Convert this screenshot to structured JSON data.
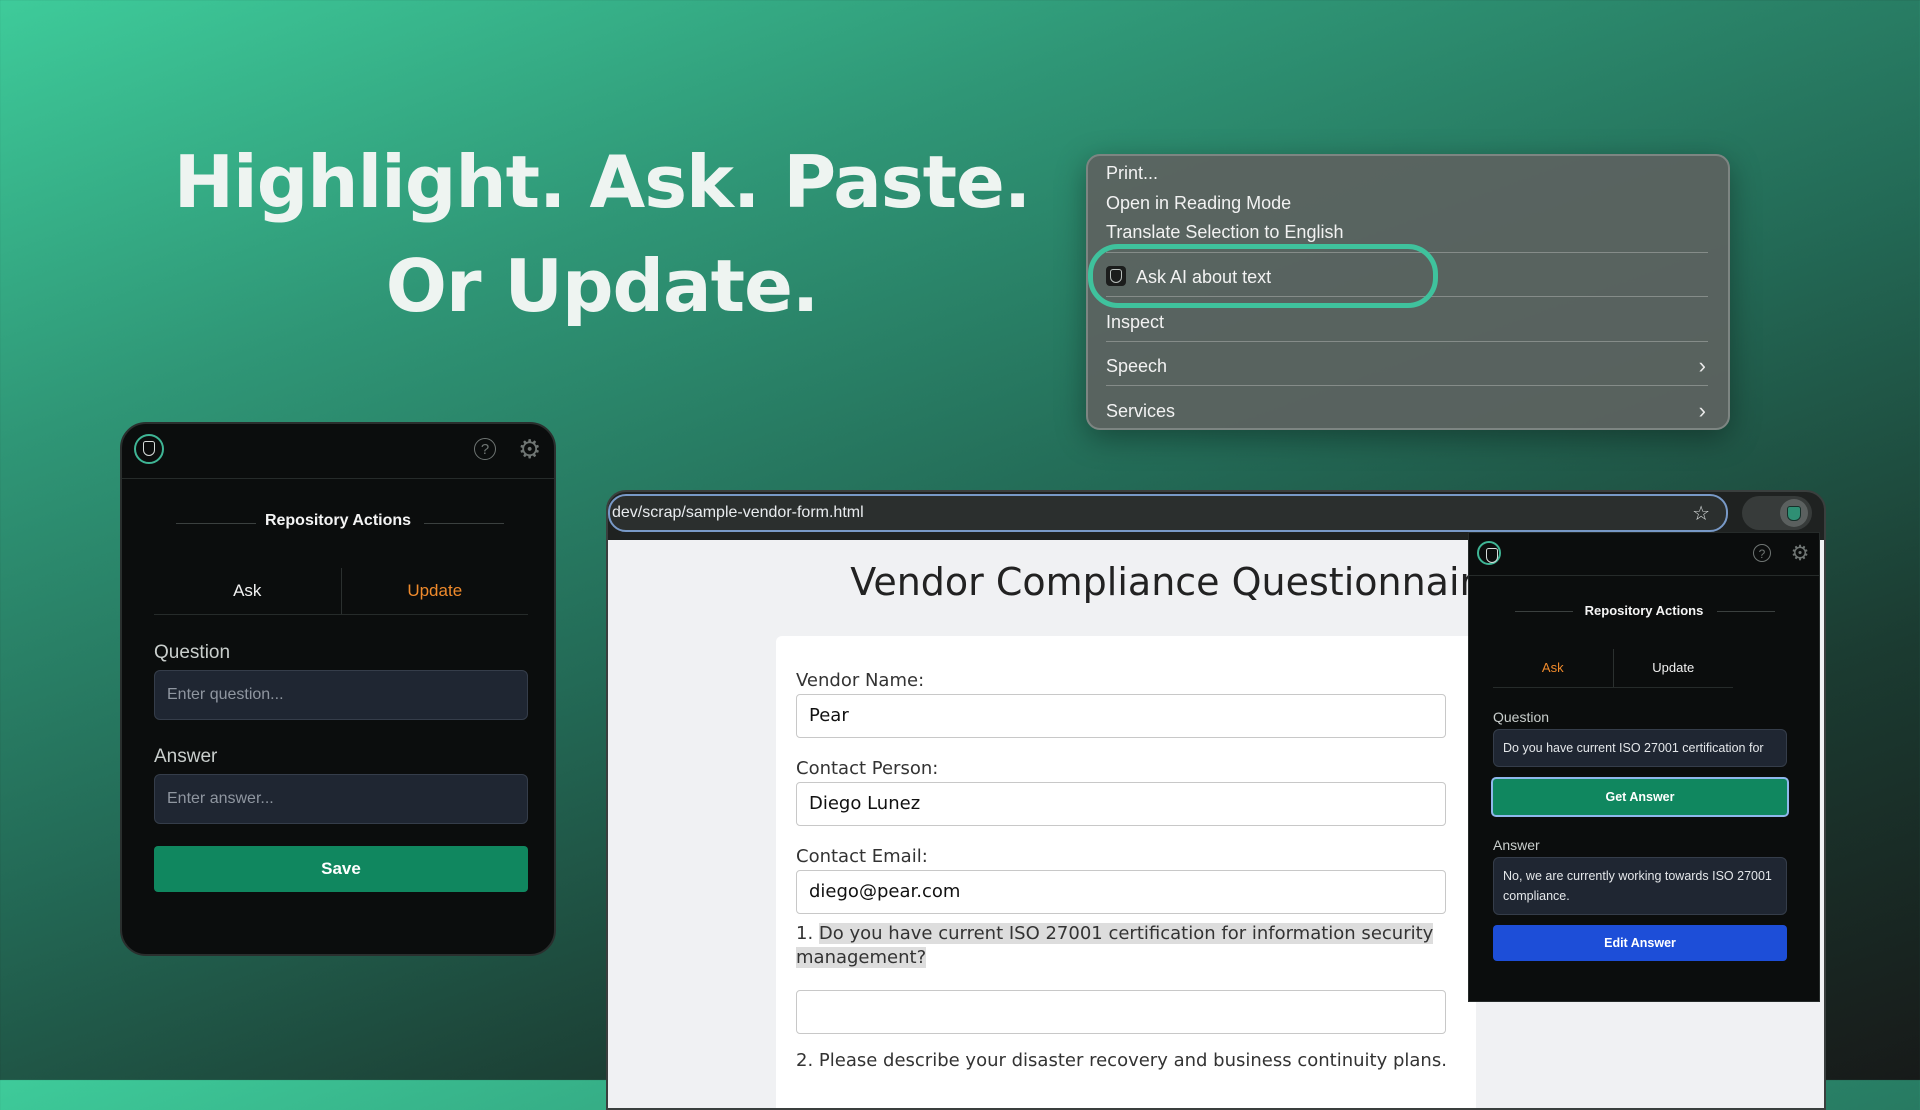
{
  "hero": {
    "line1": "Highlight. Ask. Paste.",
    "line2": "Or Update."
  },
  "context_menu": {
    "items": [
      {
        "label": "Print..."
      },
      {
        "label": "Open in Reading Mode"
      },
      {
        "label": "Translate Selection to English"
      },
      {
        "label": "Ask AI about text",
        "icon": "shield-app-icon"
      },
      {
        "label": "Inspect"
      },
      {
        "label": "Speech",
        "icon": "chevron-right-icon"
      },
      {
        "label": "Services",
        "icon": "chevron-right-icon"
      }
    ],
    "highlight_color": "#3fc29d"
  },
  "popup": {
    "title": "Repository Actions",
    "tabs": [
      {
        "label": "Ask",
        "active": false
      },
      {
        "label": "Update",
        "active": true
      }
    ],
    "question_label": "Question",
    "question_placeholder": "Enter question...",
    "answer_label": "Answer",
    "answer_placeholder": "Enter answer...",
    "save_label": "Save",
    "accent_color": "#10875f",
    "active_tab_color": "#ef8a2c"
  },
  "browser": {
    "url": "dev/scrap/sample-vendor-form.html",
    "page": {
      "title": "Vendor Compliance Questionnaire",
      "fields": [
        {
          "label": "Vendor Name:",
          "value": "Pear"
        },
        {
          "label": "Contact Person:",
          "value": "Diego Lunez"
        },
        {
          "label": "Contact Email:",
          "value": "diego@pear.com"
        }
      ],
      "q1_number": "1.",
      "q1_text": "Do you have current ISO 27001 certification for information security management?",
      "q1_answer": "",
      "q2_text": "2. Please describe your disaster recovery and business continuity plans."
    },
    "side_panel": {
      "title": "Repository Actions",
      "tabs": [
        {
          "label": "Ask",
          "active": true
        },
        {
          "label": "Update",
          "active": false
        }
      ],
      "question_label": "Question",
      "question_value": "Do you have current ISO 27001 certification for",
      "get_answer_label": "Get Answer",
      "answer_label": "Answer",
      "answer_value": "No, we are currently working towards ISO 27001 compliance.",
      "edit_answer_label": "Edit Answer",
      "get_answer_color": "#10875f",
      "edit_answer_color": "#1d4ed8"
    }
  }
}
